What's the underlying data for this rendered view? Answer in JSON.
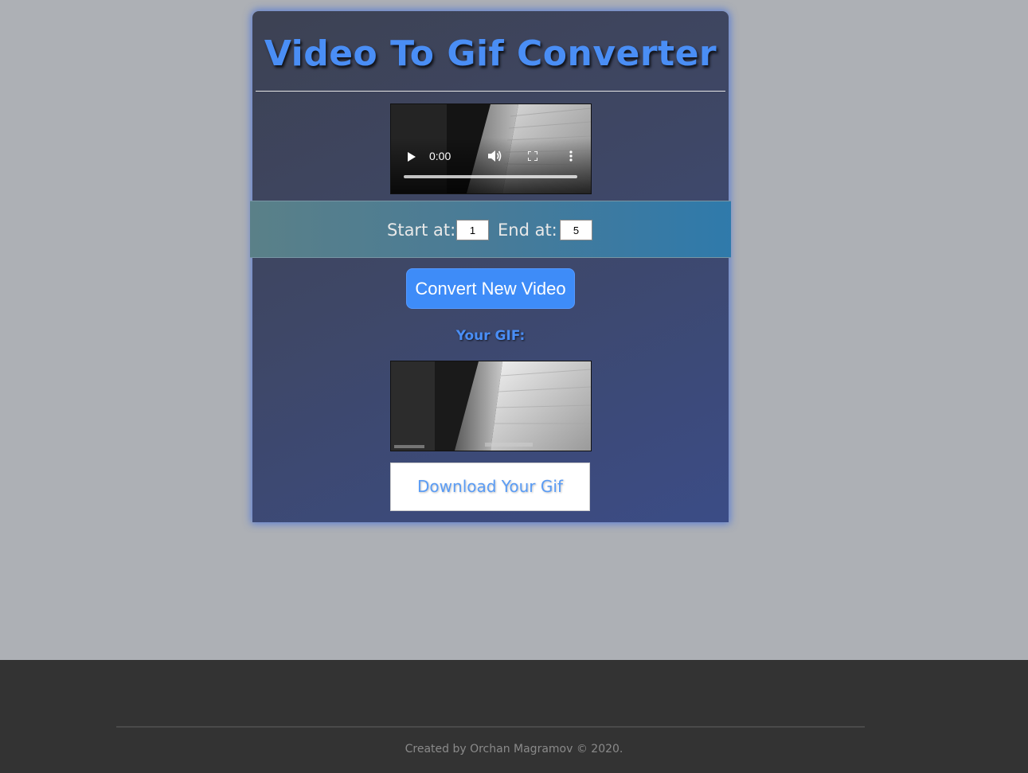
{
  "app": {
    "title": "Video To Gif Converter"
  },
  "video_player": {
    "current_time": "0:00"
  },
  "range": {
    "start_label": "Start at:",
    "start_value": "1",
    "end_label": "End at:",
    "end_value": "5"
  },
  "actions": {
    "convert_label": "Convert New Video",
    "download_label": "Download Your Gif"
  },
  "result": {
    "label": "Your GIF:"
  },
  "footer": {
    "credit": "Created by Orchan Magramov © 2020."
  },
  "colors": {
    "accent": "#4a8ef5",
    "button": "#3e8cf8",
    "background": "#adb0b5",
    "footer": "#333333"
  },
  "icons": [
    "play-icon",
    "volume-icon",
    "fullscreen-icon",
    "more-icon"
  ]
}
